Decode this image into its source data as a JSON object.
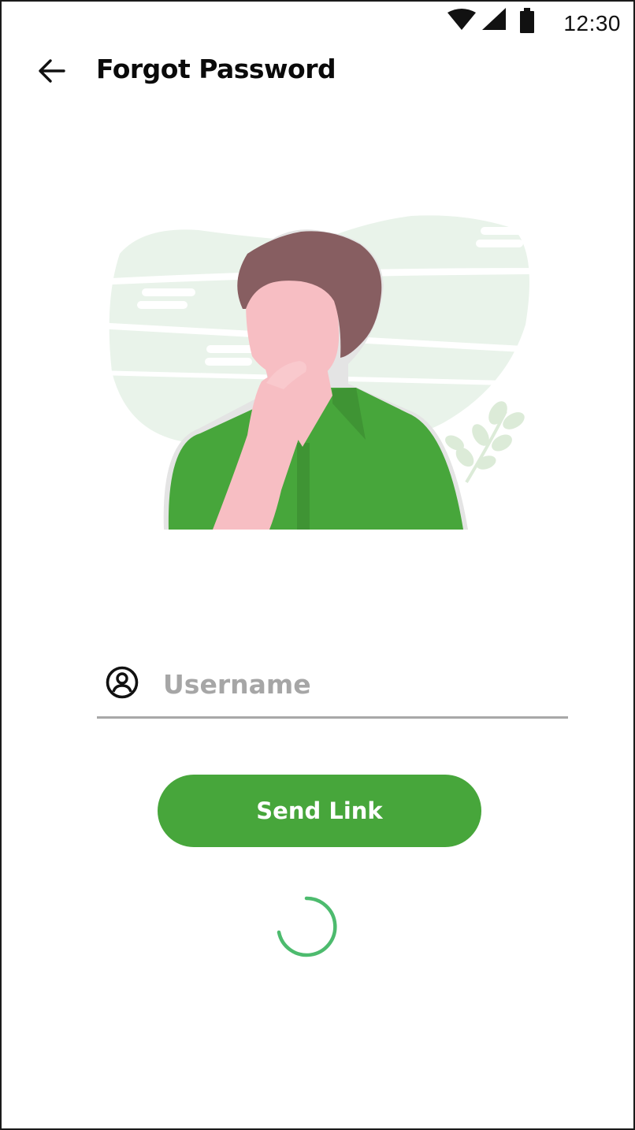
{
  "status_bar": {
    "time": "12:30",
    "icons": [
      "wifi-icon",
      "signal-icon",
      "battery-icon"
    ]
  },
  "header": {
    "back_icon": "arrow-left-icon",
    "title": "Forgot Password"
  },
  "illustration": {
    "subject": "person-thinking-illustration"
  },
  "form": {
    "username": {
      "icon": "user-circle-icon",
      "value": "",
      "placeholder": "Username"
    },
    "submit_label": "Send Link"
  },
  "loading": {
    "icon": "spinner-icon"
  },
  "colors": {
    "accent": "#47a63b",
    "spinner": "#4dbb6e",
    "placeholder": "#a6a6a6",
    "underline": "#a8a8a8"
  }
}
